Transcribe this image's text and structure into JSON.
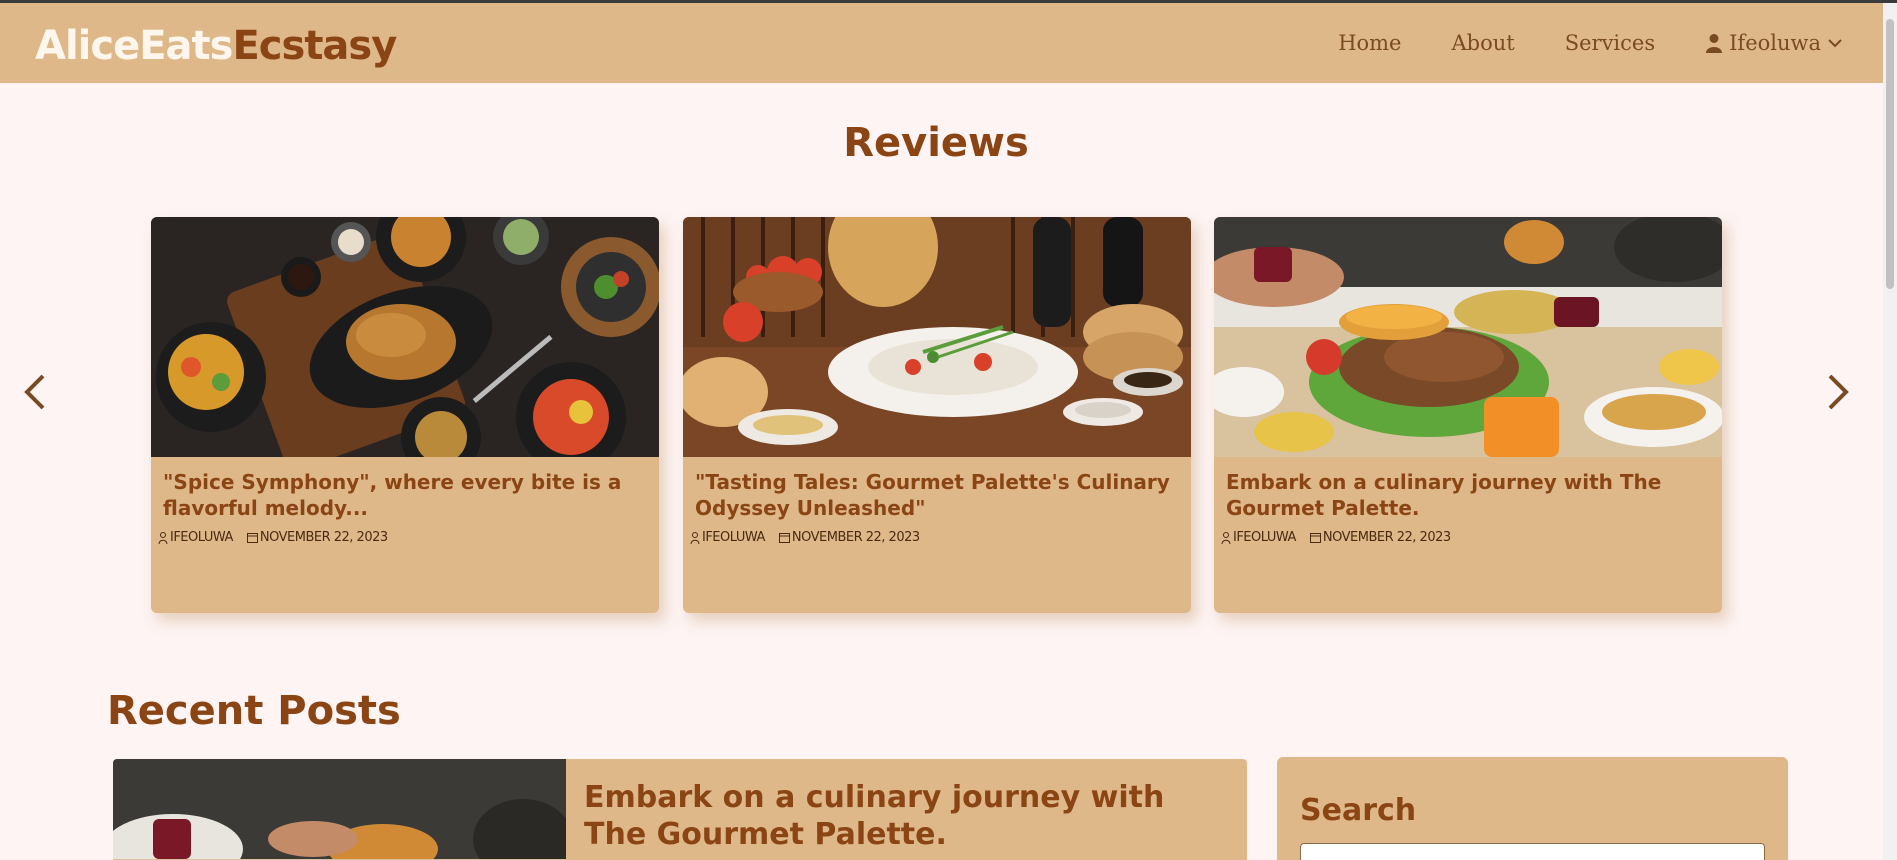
{
  "header": {
    "logo_part1": "AliceEats",
    "logo_part2": "Ecstasy",
    "nav": [
      "Home",
      "About",
      "Services"
    ],
    "user_name": "Ifeoluwa"
  },
  "reviews": {
    "heading": "Reviews",
    "cards": [
      {
        "title": "\"Spice Symphony\", where every bite is a flavorful melody...",
        "author": "IFEOLUWA",
        "date": "NOVEMBER 22, 2023"
      },
      {
        "title": "\"Tasting Tales: Gourmet Palette's Culinary Odyssey Unleashed\"",
        "author": "IFEOLUWA",
        "date": "NOVEMBER 22, 2023"
      },
      {
        "title": "Embark on a culinary journey with The Gourmet Palette.",
        "author": "IFEOLUWA",
        "date": "NOVEMBER 22, 2023"
      }
    ]
  },
  "recent": {
    "heading": "Recent Posts",
    "post_title": "Embark on a culinary journey with The Gourmet Palette."
  },
  "sidebar": {
    "search_heading": "Search",
    "search_placeholder": ""
  },
  "colors": {
    "accent": "#8b4515",
    "panel": "#dfb88a",
    "background": "#fdf4f3"
  }
}
